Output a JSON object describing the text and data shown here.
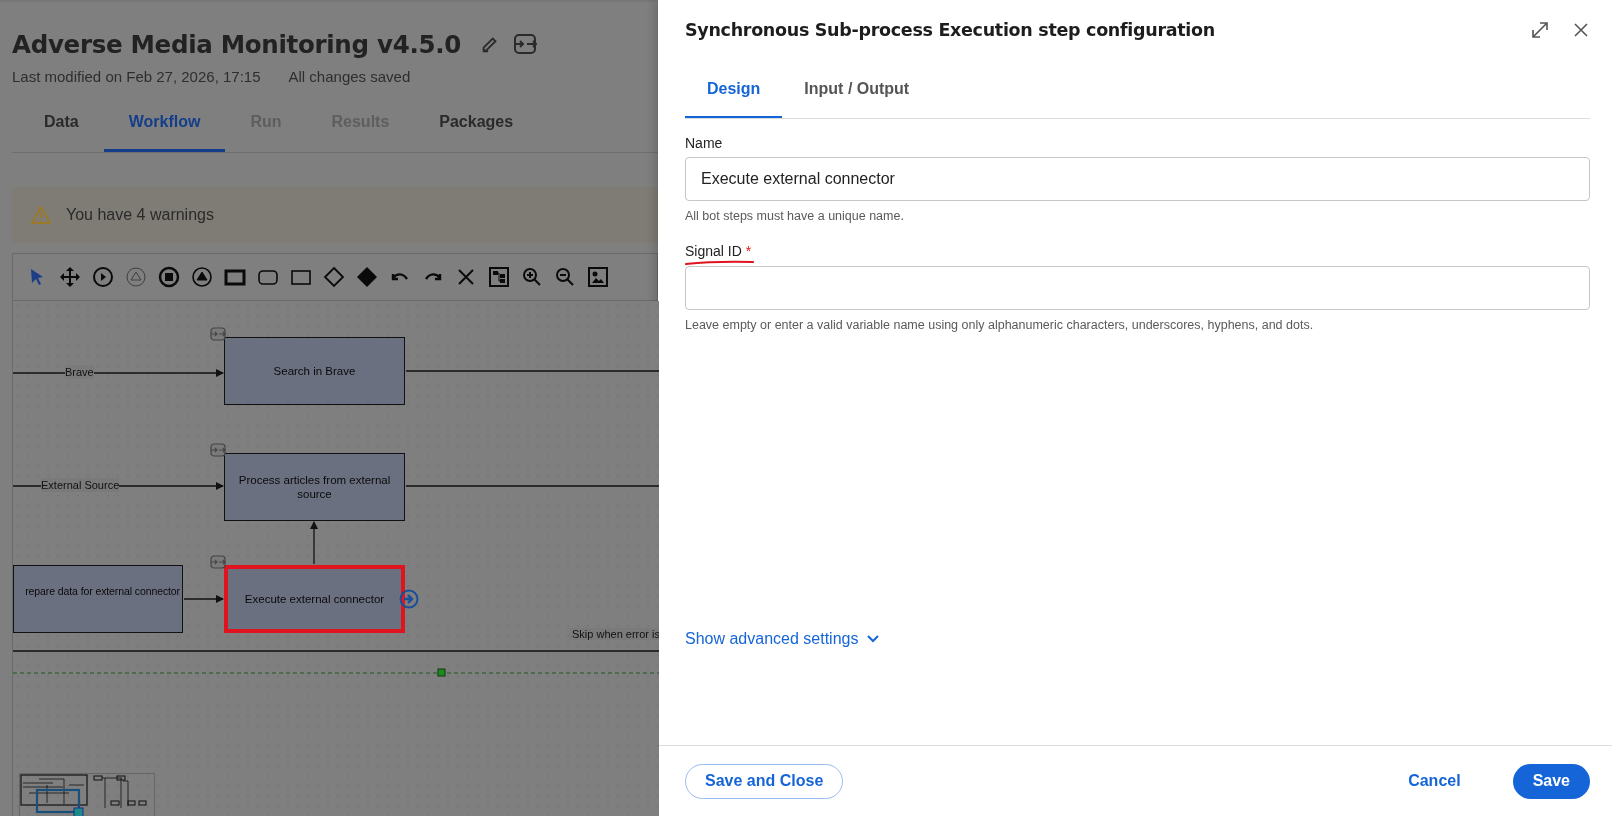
{
  "page": {
    "title": "Adverse Media Monitoring v4.5.0",
    "modified": "Last modified on Feb 27, 2026, 17:15",
    "save_status": "All changes saved"
  },
  "tabs": [
    {
      "label": "Data",
      "selected": false,
      "disabled": false
    },
    {
      "label": "Workflow",
      "selected": true,
      "disabled": false
    },
    {
      "label": "Run",
      "selected": false,
      "disabled": true
    },
    {
      "label": "Results",
      "selected": false,
      "disabled": true
    },
    {
      "label": "Packages",
      "selected": false,
      "disabled": false
    }
  ],
  "warning": {
    "text": "You have 4 warnings"
  },
  "toolbar": [
    {
      "kind": "pointer",
      "selected": true,
      "disabled": false
    },
    {
      "kind": "move",
      "selected": false,
      "disabled": false
    },
    {
      "kind": "start",
      "selected": false,
      "disabled": false
    },
    {
      "kind": "signal",
      "selected": false,
      "disabled": true
    },
    {
      "kind": "end",
      "selected": false,
      "disabled": false
    },
    {
      "kind": "signal",
      "selected": false,
      "disabled": false
    },
    {
      "kind": "subprocess",
      "selected": false,
      "disabled": false
    },
    {
      "kind": "task",
      "selected": false,
      "disabled": false
    },
    {
      "kind": "rect",
      "selected": false,
      "disabled": false
    },
    {
      "kind": "gateway",
      "selected": false,
      "disabled": false
    },
    {
      "kind": "gateway-filled",
      "selected": false,
      "disabled": false
    },
    {
      "kind": "undo",
      "selected": false,
      "disabled": false
    },
    {
      "kind": "redo",
      "selected": false,
      "disabled": false
    },
    {
      "kind": "delete",
      "selected": false,
      "disabled": false
    },
    {
      "kind": "layout",
      "selected": false,
      "disabled": false
    },
    {
      "kind": "zoom-in",
      "selected": false,
      "disabled": false
    },
    {
      "kind": "zoom-out",
      "selected": false,
      "disabled": false
    },
    {
      "kind": "export",
      "selected": false,
      "disabled": false
    }
  ],
  "diagram": {
    "nodes": [
      {
        "label": "Search in Brave",
        "highlighted": false,
        "subprocess": true
      },
      {
        "label": "Process articles from external source",
        "highlighted": false,
        "subprocess": true
      },
      {
        "label": "repare data for external connector",
        "highlighted": false,
        "subprocess": false
      },
      {
        "label": "Execute external connector",
        "highlighted": true,
        "subprocess": true
      }
    ],
    "edge_labels": [
      "Brave",
      "External Source"
    ],
    "note": "Skip when error is"
  },
  "drawer": {
    "title": "Synchronous Sub-process Execution step configuration",
    "tabs": [
      {
        "label": "Design",
        "selected": true
      },
      {
        "label": "Input / Output",
        "selected": false
      }
    ],
    "fields": [
      {
        "label": "Name",
        "annotated": false,
        "value": "Execute external connector",
        "hint": "All bot steps must have a unique name."
      },
      {
        "label": "Signal ID",
        "required_mark": "*",
        "annotated": true,
        "hint": "Leave empty or enter a valid variable name using only alphanumeric characters, underscores, hyphens, and dots."
      }
    ],
    "advanced": "Show advanced settings",
    "buttons": [
      {
        "label": "Save and Close",
        "kind": "outline"
      },
      {
        "label": "Cancel",
        "kind": "text"
      },
      {
        "label": "Save",
        "kind": "primary"
      }
    ]
  }
}
